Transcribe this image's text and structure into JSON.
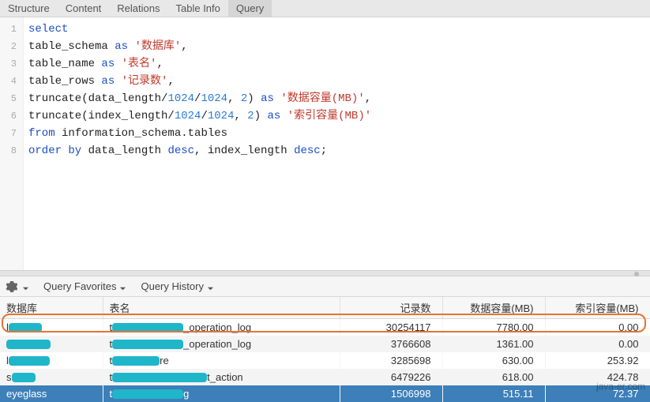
{
  "tabs": {
    "items": [
      "Structure",
      "Content",
      "Relations",
      "Table Info",
      "Query"
    ],
    "active_index": 4
  },
  "sql": {
    "lines": [
      [
        {
          "t": "kw",
          "v": "select"
        }
      ],
      [
        {
          "t": "ident",
          "v": "table_schema "
        },
        {
          "t": "kw",
          "v": "as"
        },
        {
          "t": "ident",
          "v": " "
        },
        {
          "t": "str",
          "v": "'数据库'"
        },
        {
          "t": "ident",
          "v": ","
        }
      ],
      [
        {
          "t": "ident",
          "v": "table_name "
        },
        {
          "t": "kw",
          "v": "as"
        },
        {
          "t": "ident",
          "v": " "
        },
        {
          "t": "str",
          "v": "'表名'"
        },
        {
          "t": "ident",
          "v": ","
        }
      ],
      [
        {
          "t": "ident",
          "v": "table_rows "
        },
        {
          "t": "kw",
          "v": "as"
        },
        {
          "t": "ident",
          "v": " "
        },
        {
          "t": "str",
          "v": "'记录数'"
        },
        {
          "t": "ident",
          "v": ","
        }
      ],
      [
        {
          "t": "ident",
          "v": "truncate(data_length/"
        },
        {
          "t": "num",
          "v": "1024"
        },
        {
          "t": "ident",
          "v": "/"
        },
        {
          "t": "num",
          "v": "1024"
        },
        {
          "t": "ident",
          "v": ", "
        },
        {
          "t": "num",
          "v": "2"
        },
        {
          "t": "ident",
          "v": ") "
        },
        {
          "t": "kw",
          "v": "as"
        },
        {
          "t": "ident",
          "v": " "
        },
        {
          "t": "str",
          "v": "'数据容量(MB)'"
        },
        {
          "t": "ident",
          "v": ","
        }
      ],
      [
        {
          "t": "ident",
          "v": "truncate(index_length/"
        },
        {
          "t": "num",
          "v": "1024"
        },
        {
          "t": "ident",
          "v": "/"
        },
        {
          "t": "num",
          "v": "1024"
        },
        {
          "t": "ident",
          "v": ", "
        },
        {
          "t": "num",
          "v": "2"
        },
        {
          "t": "ident",
          "v": ") "
        },
        {
          "t": "kw",
          "v": "as"
        },
        {
          "t": "ident",
          "v": " "
        },
        {
          "t": "str",
          "v": "'索引容量(MB)'"
        }
      ],
      [
        {
          "t": "kw",
          "v": "from"
        },
        {
          "t": "ident",
          "v": " information_schema.tables"
        }
      ],
      [
        {
          "t": "kw",
          "v": "order by"
        },
        {
          "t": "ident",
          "v": " data_length "
        },
        {
          "t": "kw",
          "v": "desc"
        },
        {
          "t": "ident",
          "v": ", index_length "
        },
        {
          "t": "kw",
          "v": "desc"
        },
        {
          "t": "ident",
          "v": ";"
        }
      ]
    ]
  },
  "toolbar": {
    "favorites_label": "Query Favorites",
    "history_label": "Query History"
  },
  "results": {
    "columns": [
      "数据库",
      "表名",
      "记录数",
      "数据容量(MB)",
      "索引容量(MB)"
    ],
    "col_widths": [
      "130px",
      "300px",
      "130px",
      "130px",
      "133px"
    ],
    "col_align": [
      "left",
      "left",
      "right",
      "right",
      "right"
    ],
    "highlight_row_index": 0,
    "selected_row_index": 4,
    "rows": [
      {
        "db_redact_w": 42,
        "db_prefix": "l",
        "tbl_redact_w": 90,
        "tbl_prefix": "t",
        "tbl_suffix": "_operation_log",
        "rows_c": "30254117",
        "data_mb": "7780.00",
        "idx_mb": "0.00"
      },
      {
        "db_redact_w": 56,
        "db_prefix": "",
        "tbl_redact_w": 90,
        "tbl_prefix": "t",
        "tbl_suffix": "_operation_log",
        "rows_c": "3766608",
        "data_mb": "1361.00",
        "idx_mb": "0.00"
      },
      {
        "db_redact_w": 52,
        "db_prefix": "l",
        "tbl_redact_w": 60,
        "tbl_prefix": "t",
        "tbl_suffix": "re",
        "rows_c": "3285698",
        "data_mb": "630.00",
        "idx_mb": "253.92"
      },
      {
        "db_redact_w": 30,
        "db_prefix": "s",
        "tbl_redact_w": 120,
        "tbl_prefix": "t",
        "tbl_suffix": "t_action",
        "rows_c": "6479226",
        "data_mb": "618.00",
        "idx_mb": "424.78"
      },
      {
        "db_redact_w": 0,
        "db_prefix": "eyeglass",
        "tbl_redact_w": 90,
        "tbl_prefix": "t",
        "tbl_suffix": "g",
        "rows_c": "1506998",
        "data_mb": "515.11",
        "idx_mb": "72.37"
      }
    ]
  },
  "watermark": "java-er.com"
}
